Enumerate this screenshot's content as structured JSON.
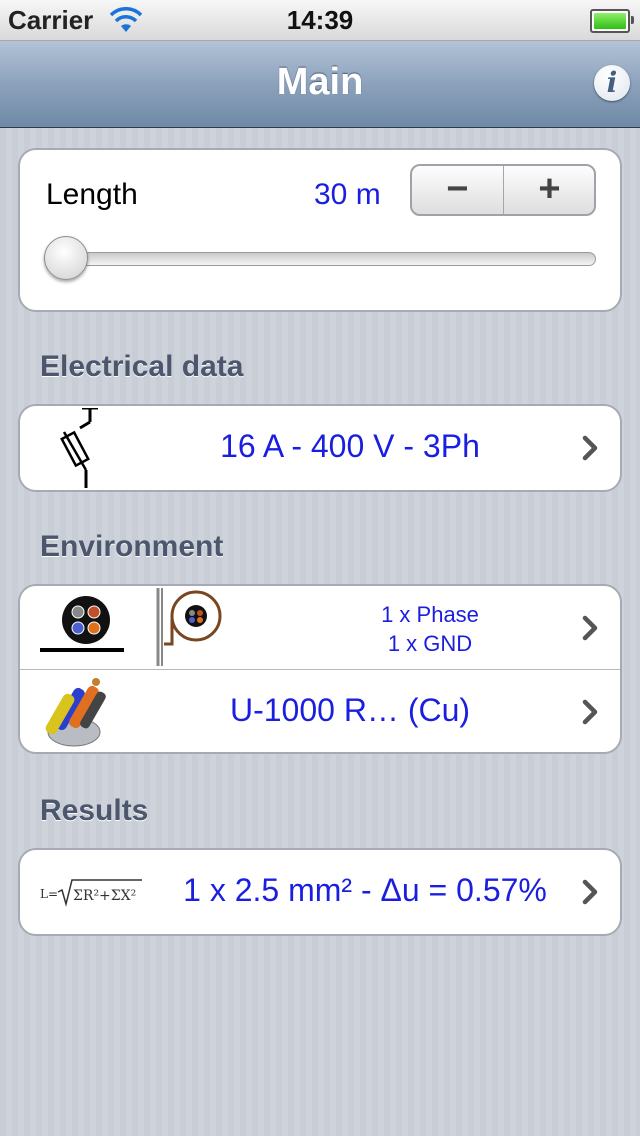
{
  "status_bar": {
    "carrier": "Carrier",
    "time": "14:39"
  },
  "nav": {
    "title": "Main",
    "info_icon": "info-icon"
  },
  "length": {
    "label": "Length",
    "value": "30 m",
    "minus_label": "−",
    "plus_label": "+",
    "slider_fraction": 0.02
  },
  "electrical": {
    "header": "Electrical data",
    "value": "16 A - 400 V - 3Ph",
    "icon": "fuse-icon"
  },
  "environment": {
    "header": "Environment",
    "installation": {
      "line1": "1 x Phase",
      "line2": "1 x GND",
      "icons": [
        "cable-on-floor-icon",
        "cable-in-conduit-icon"
      ]
    },
    "cable": {
      "value": "U-1000 R… (Cu)",
      "icon": "cable-bundle-icon"
    }
  },
  "results": {
    "header": "Results",
    "value": "1 x 2.5 mm² - Δu = 0.57%",
    "icon": "formula-icon"
  },
  "colors": {
    "accent_blue": "#1a1ee0",
    "nav_bar": "#8ca2bc",
    "section_header": "#4c566c"
  }
}
